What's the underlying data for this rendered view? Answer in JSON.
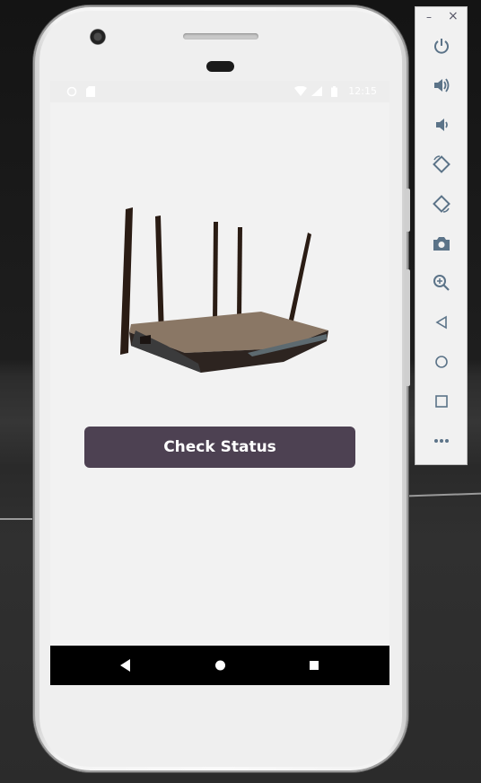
{
  "app": {
    "button_label": "Check Status"
  },
  "status_bar": {
    "time": "12:15",
    "icons": [
      "sync-icon",
      "sd-card-icon",
      "wifi-icon",
      "signal-icon",
      "battery-icon"
    ]
  },
  "nav_bar": {
    "icons": [
      "back-icon",
      "home-icon",
      "recents-icon"
    ]
  },
  "emulator_toolbar": {
    "minimize_label": "–",
    "close_label": "×",
    "icons": [
      "power-icon",
      "volume-up-icon",
      "volume-down-icon",
      "rotate-left-icon",
      "rotate-right-icon",
      "camera-icon",
      "zoom-icon",
      "back-icon",
      "home-icon",
      "overview-icon",
      "more-icon"
    ]
  },
  "colors": {
    "button_bg": "#4d4152",
    "button_text": "#ffffff",
    "screen_bg": "#f2f2f2",
    "nav_bar_bg": "#000000",
    "toolbar_icon": "#5b7388"
  }
}
